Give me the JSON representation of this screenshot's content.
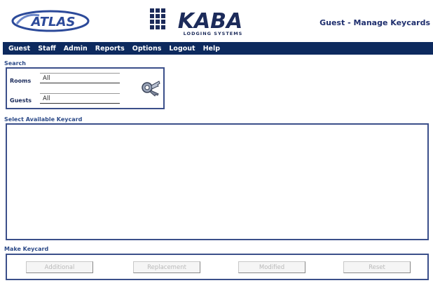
{
  "header": {
    "page_title": "Guest - Manage Keycards",
    "atlas_logo_text": "ATLAS",
    "kaba_logo_text": "KABA",
    "kaba_logo_subtitle": "LODGING SYSTEMS"
  },
  "nav": {
    "items": [
      "Guest",
      "Staff",
      "Admin",
      "Reports",
      "Options",
      "Logout",
      "Help"
    ]
  },
  "search": {
    "section_label": "Search",
    "rooms_label": "Rooms",
    "rooms_value": "All",
    "guests_label": "Guests",
    "guests_value": "All",
    "icon": "keys-search-icon"
  },
  "keycards": {
    "section_label": "Select Available Keycard",
    "items": []
  },
  "make_keycard": {
    "section_label": "Make Keycard",
    "buttons": [
      "Additional",
      "Replacement",
      "Modified",
      "Reset"
    ]
  },
  "colors": {
    "nav_bg": "#0d2a5e",
    "border": "#3b4f8a",
    "label": "#2c4a88",
    "disabled_text": "#b9b9b9"
  }
}
